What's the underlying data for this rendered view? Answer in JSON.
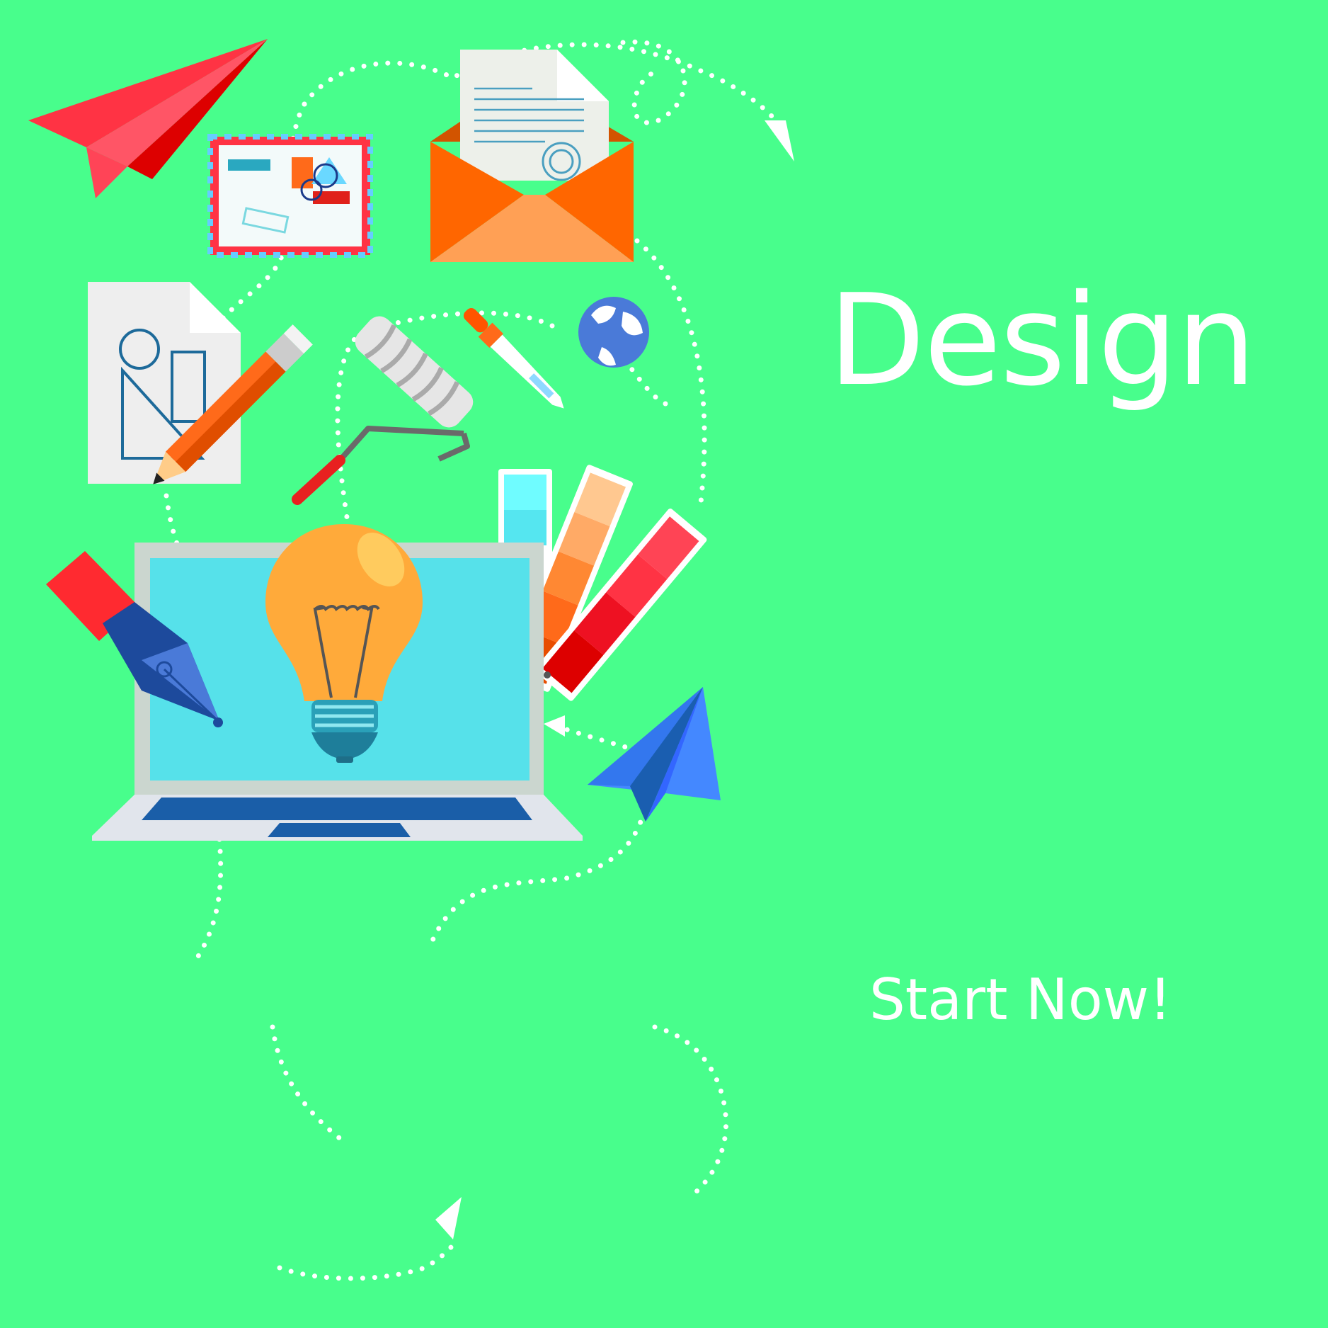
{
  "headline": "Design",
  "cta_label": "Start Now!",
  "colors": {
    "background": "#48fe8c",
    "text": "#ffffff",
    "paper_plane_red": "#ff3344",
    "paper_plane_blue": "#4488ff",
    "envelope_orange": "#ff6600",
    "bulb_orange": "#ffaa3a",
    "laptop_screen": "#56e1ea"
  },
  "icons": [
    "paper-plane-red-icon",
    "airmail-envelope-icon",
    "open-envelope-letter-icon",
    "document-geometry-icon",
    "pencil-icon",
    "paint-roller-icon",
    "pipette-icon",
    "globe-icon",
    "laptop-icon",
    "lightbulb-icon",
    "fountain-pen-icon",
    "color-swatch-icon",
    "paper-plane-blue-icon",
    "arrow-head-icon"
  ]
}
